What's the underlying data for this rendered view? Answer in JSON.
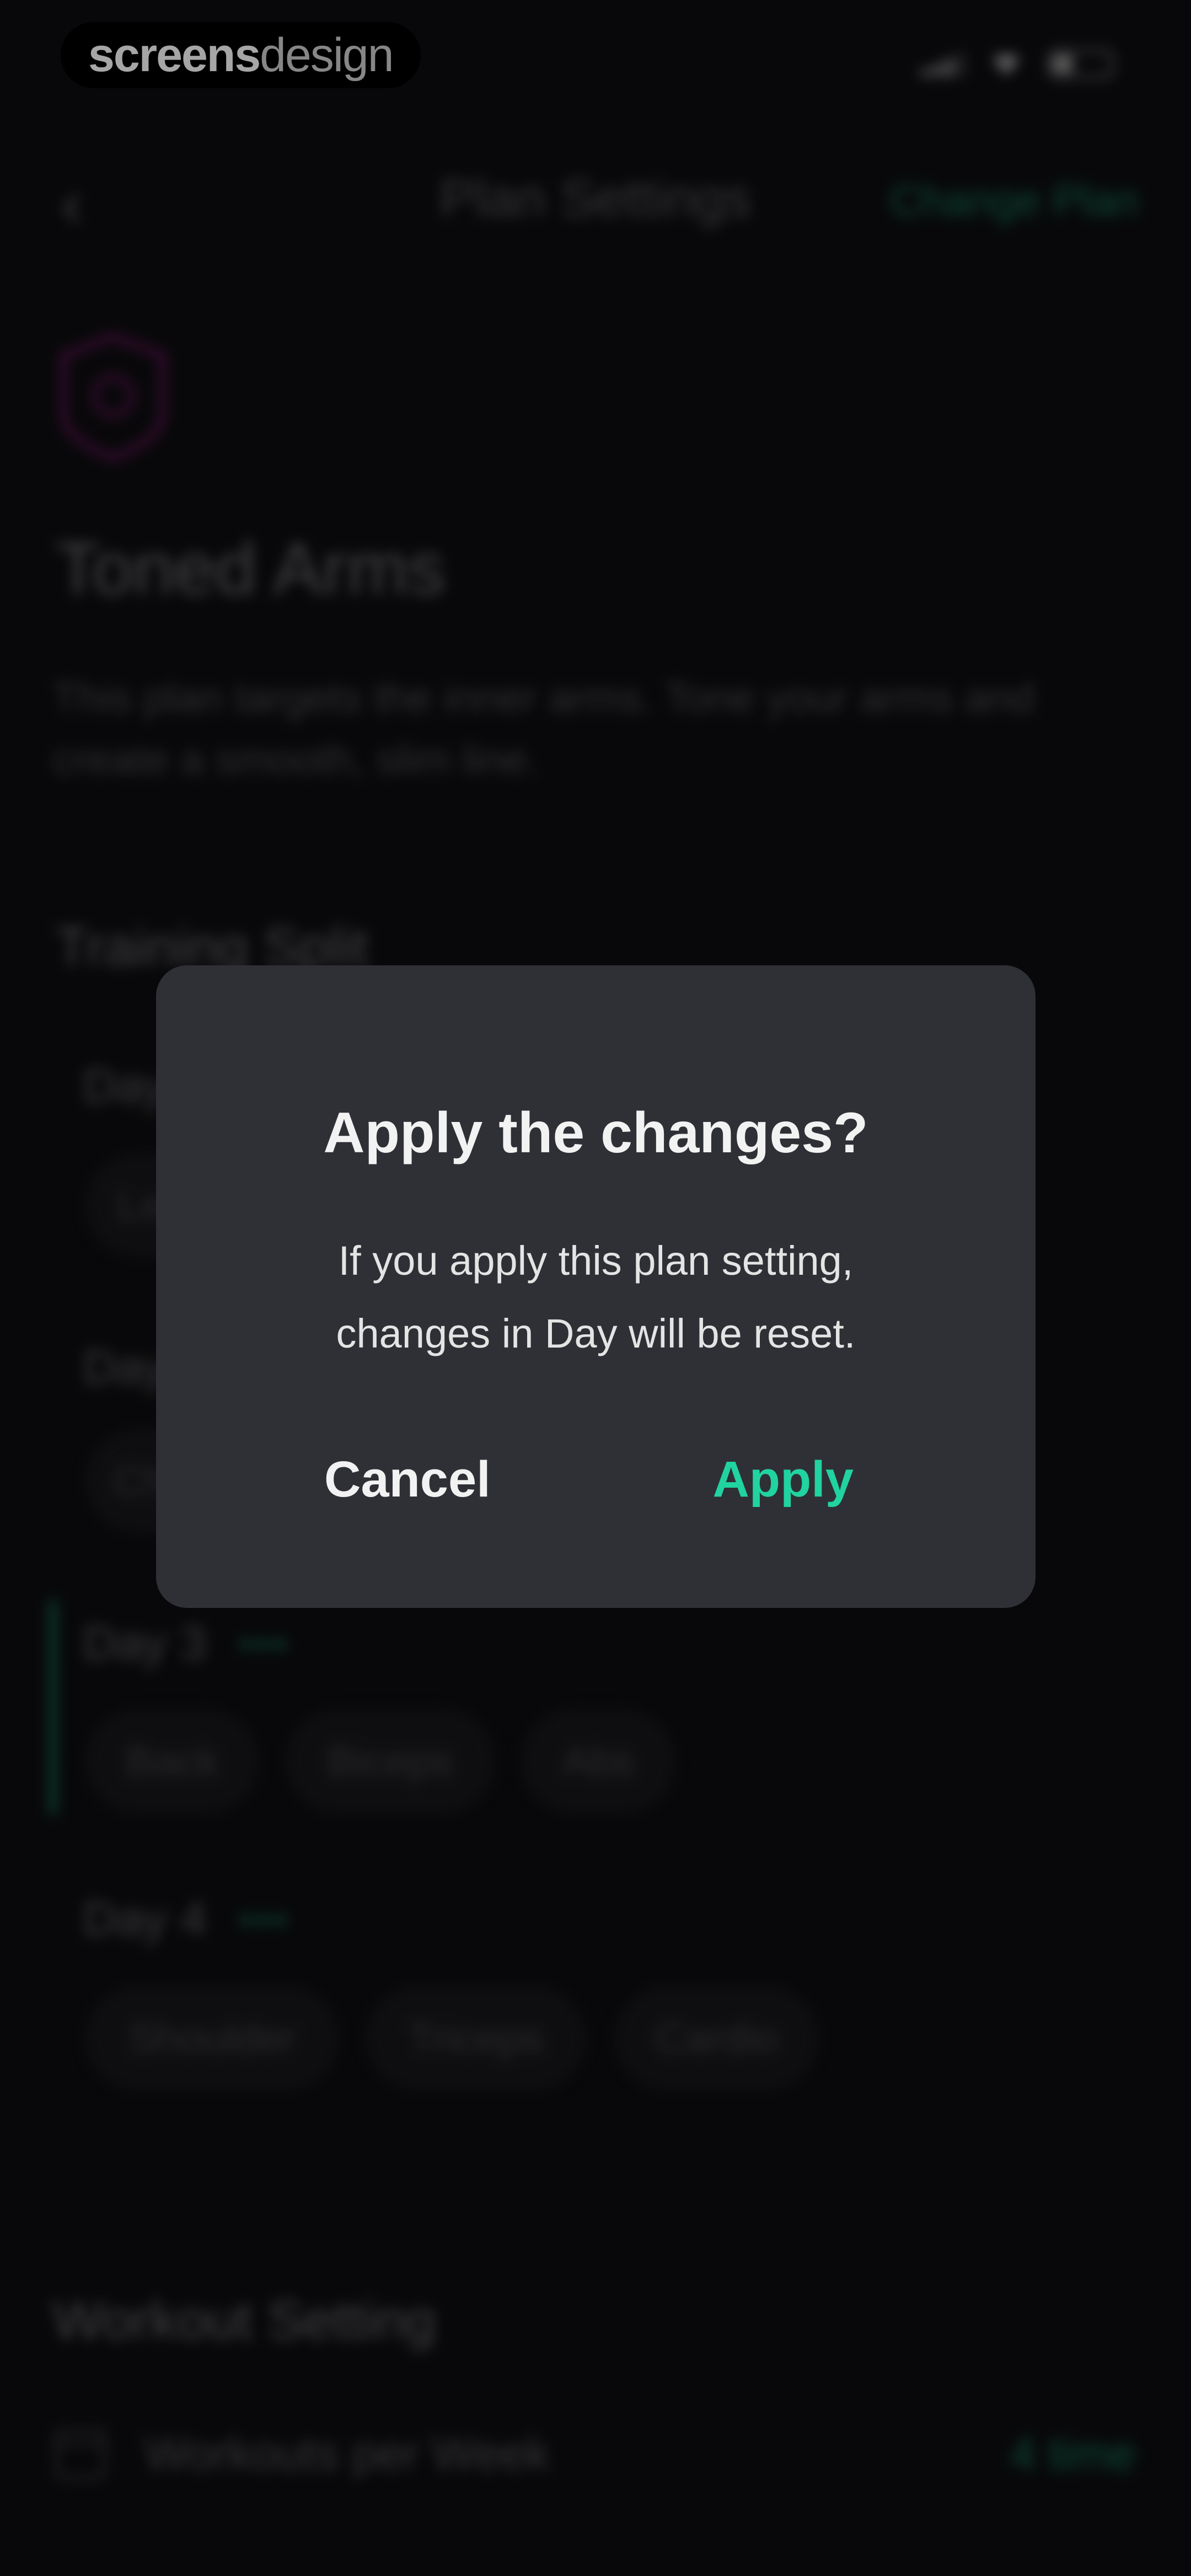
{
  "watermark": {
    "bold": "screens",
    "light": "design"
  },
  "header": {
    "back_icon": "‹",
    "title": "Plan Settings",
    "change_plan": "Change Plan"
  },
  "plan": {
    "badge_icon": "shield-badge-icon",
    "title": "Toned Arms",
    "description": "This plan targets the inner arms. Tone your arms and create a smooth, slim line."
  },
  "training_split": {
    "title": "Training Split",
    "days": [
      {
        "label": "Day 1",
        "chips": [
          "Legs"
        ]
      },
      {
        "label": "Day 2",
        "chips": [
          "Chest"
        ]
      },
      {
        "label": "Day 3",
        "dots": "•••",
        "chips": [
          "Back",
          "Biceps",
          "Abs"
        ]
      },
      {
        "label": "Day 4",
        "dots": "•••",
        "chips": [
          "Shoulder",
          "Triceps",
          "Cardio"
        ]
      }
    ]
  },
  "workout_setting": {
    "title": "Workout Setting",
    "rows": [
      {
        "icon": "calendar-icon",
        "label": "Workouts per Week",
        "value": "4 time"
      }
    ]
  },
  "dialog": {
    "title": "Apply the changes?",
    "message_line1": "If you apply this plan setting,",
    "message_line2": "changes in Day will be reset.",
    "cancel": "Cancel",
    "apply": "Apply"
  },
  "colors": {
    "accent": "#21d3a0",
    "dialog_bg": "#2e3035",
    "screen_bg": "#0d0d10",
    "badge": "#8b1a7a"
  }
}
